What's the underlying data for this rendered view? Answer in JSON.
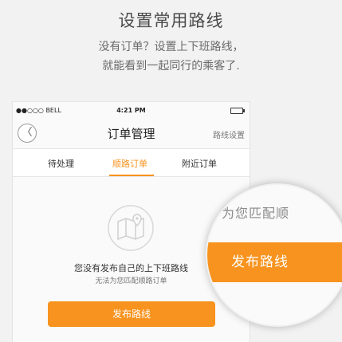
{
  "promo": {
    "title": "设置常用路线",
    "line1": "没有订单？设置上下班路线，",
    "line2": "就能看到一起同行的乘客了."
  },
  "status_bar": {
    "carrier": "●●○○○ BELL",
    "time": "4:21 PM"
  },
  "navbar": {
    "back_label": "〈",
    "title": "订单管理",
    "right_label": "路线设置"
  },
  "tabs": [
    {
      "label": "待处理"
    },
    {
      "label": "顺路订单"
    },
    {
      "label": "附近订单"
    }
  ],
  "active_tab": 1,
  "empty_state": {
    "icon": "map-pin-icon",
    "message": "您没有发布自己的上下班路线",
    "submessage": "无法为您匹配顺路订单"
  },
  "publish_button_label": "发布路线",
  "magnifier": {
    "partial_text": "为您匹配顺",
    "button_label": "发布路线"
  },
  "colors": {
    "accent": "#f7931e",
    "background": "#f2f2f2"
  }
}
